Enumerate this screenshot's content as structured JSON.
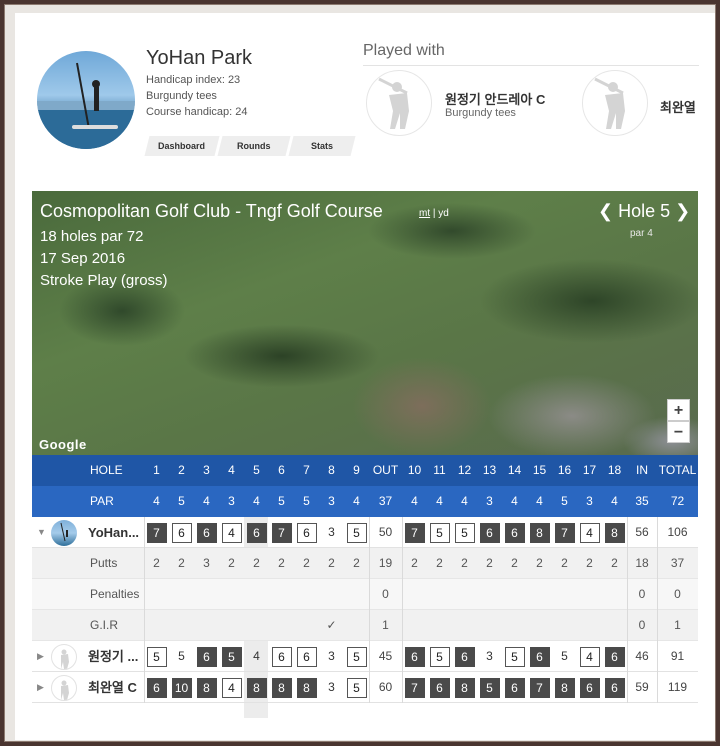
{
  "profile": {
    "name": "YoHan Park",
    "handicap_index": "Handicap index: 23",
    "tees": "Burgundy tees",
    "course_handicap": "Course handicap: 24",
    "tabs": [
      "Dashboard",
      "Rounds",
      "Stats"
    ]
  },
  "played_with": {
    "title": "Played with",
    "players": [
      {
        "name": "원정기 안드레아 C",
        "tees": "Burgundy tees"
      },
      {
        "name": "최완열",
        "tees": ""
      }
    ]
  },
  "course": {
    "title": "Cosmopolitan Golf Club - Tngf Golf Course",
    "units": {
      "mt": "mt",
      "sep": "|",
      "yd": "yd"
    },
    "holes_par": "18 holes par 72",
    "date": "17 Sep 2016",
    "format": "Stroke Play (gross)",
    "hole_nav": {
      "prev": "❮",
      "label": "Hole 5",
      "next": "❯",
      "par": "par 4"
    },
    "zoom_in": "+",
    "zoom_out": "−",
    "map_brand": "Google"
  },
  "scorecard": {
    "hole_label": "HOLE",
    "par_label": "PAR",
    "holes": [
      "1",
      "2",
      "3",
      "4",
      "5",
      "6",
      "7",
      "8",
      "9",
      "OUT",
      "10",
      "11",
      "12",
      "13",
      "14",
      "15",
      "16",
      "17",
      "18",
      "IN",
      "TOTAL"
    ],
    "par": [
      "4",
      "5",
      "4",
      "3",
      "4",
      "5",
      "5",
      "3",
      "4",
      "37",
      "4",
      "4",
      "4",
      "3",
      "4",
      "4",
      "5",
      "3",
      "4",
      "35",
      "72"
    ],
    "players": [
      {
        "name": "YoHan...",
        "scores": [
          "7",
          "6",
          "6",
          "4",
          "6",
          "7",
          "6",
          "3",
          "5",
          "50",
          "7",
          "5",
          "5",
          "6",
          "6",
          "8",
          "7",
          "4",
          "8",
          "56",
          "106"
        ],
        "styles": [
          "d",
          "b",
          "d",
          "b",
          "d",
          "d",
          "b",
          "p",
          "b",
          "t",
          "d",
          "b",
          "b",
          "d",
          "d",
          "d",
          "d",
          "b",
          "d",
          "t",
          "t"
        ],
        "expanded": true,
        "stats": [
          {
            "label": "Putts",
            "values": [
              "2",
              "2",
              "3",
              "2",
              "2",
              "2",
              "2",
              "2",
              "2",
              "19",
              "2",
              "2",
              "2",
              "2",
              "2",
              "2",
              "2",
              "2",
              "2",
              "18",
              "37"
            ]
          },
          {
            "label": "Penalties",
            "values": [
              "",
              "",
              "",
              "",
              "",
              "",
              "",
              "",
              "",
              "0",
              "",
              "",
              "",
              "",
              "",
              "",
              "",
              "",
              "",
              "0",
              "0"
            ]
          },
          {
            "label": "G.I.R",
            "values": [
              "",
              "",
              "",
              "",
              "",
              "",
              "",
              "✓",
              "",
              "1",
              "",
              "",
              "",
              "",
              "",
              "",
              "",
              "",
              "",
              "0",
              "1"
            ]
          }
        ]
      },
      {
        "name": "원정기 ...",
        "scores": [
          "5",
          "5",
          "6",
          "5",
          "4",
          "6",
          "6",
          "3",
          "5",
          "45",
          "6",
          "5",
          "6",
          "3",
          "5",
          "6",
          "5",
          "4",
          "6",
          "46",
          "91"
        ],
        "styles": [
          "b",
          "p",
          "d",
          "d",
          "p",
          "b",
          "b",
          "p",
          "b",
          "t",
          "d",
          "b",
          "d",
          "p",
          "b",
          "d",
          "p",
          "b",
          "d",
          "t",
          "t"
        ],
        "expanded": false
      },
      {
        "name": "최완열 C",
        "scores": [
          "6",
          "10",
          "8",
          "4",
          "8",
          "8",
          "8",
          "3",
          "5",
          "60",
          "7",
          "6",
          "8",
          "5",
          "6",
          "7",
          "8",
          "6",
          "6",
          "59",
          "119"
        ],
        "styles": [
          "d",
          "d",
          "d",
          "b",
          "d",
          "d",
          "d",
          "p",
          "b",
          "t",
          "d",
          "d",
          "d",
          "d",
          "d",
          "d",
          "d",
          "d",
          "d",
          "t",
          "t"
        ],
        "expanded": false
      }
    ]
  }
}
